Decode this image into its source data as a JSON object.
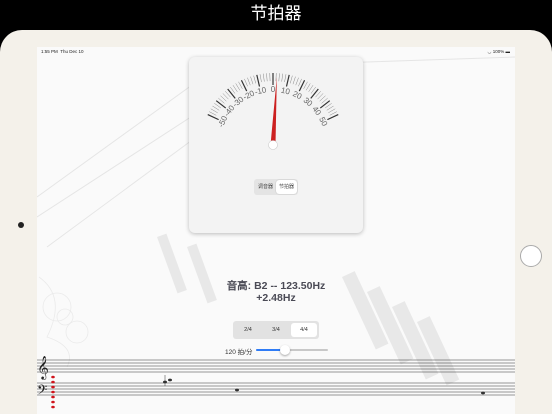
{
  "caption": "节拍器",
  "status": {
    "time": "1:55 PM",
    "date": "Thu Dec 10",
    "battery": "100%"
  },
  "tuner": {
    "scale_labels": [
      "-50",
      "-40",
      "-30",
      "-20",
      "-10",
      "0",
      "10",
      "20",
      "30",
      "40",
      "50"
    ],
    "needle_cents": 2.48,
    "tabs": [
      "调音器",
      "节拍器"
    ],
    "selected_tab": "节拍器"
  },
  "pitch": {
    "line1": "音高: B2 -- 123.50Hz",
    "line2": "+2.48Hz"
  },
  "time_signature": {
    "options": [
      "2/4",
      "3/4",
      "4/4"
    ],
    "selected": "4/4"
  },
  "tempo": {
    "label": "120 拍/分",
    "value": 120,
    "min": 40,
    "max": 240
  },
  "colors": {
    "accent": "#2f7cf6",
    "needle": "#cc2020",
    "note_red": "#d0141c"
  }
}
